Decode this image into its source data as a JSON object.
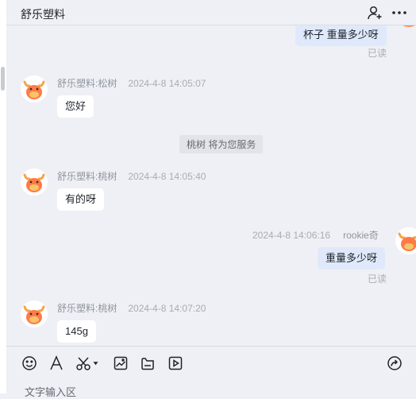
{
  "header": {
    "title": "舒乐塑料"
  },
  "messages": {
    "m0": {
      "text": "杯子 重量多少呀",
      "read": "已读"
    },
    "m1": {
      "sender": "舒乐塑料:松树",
      "time": "2024-4-8 14:05:07",
      "text": "您好"
    },
    "system": {
      "text": "桃树 将为您服务"
    },
    "m2": {
      "sender": "舒乐塑料:桃树",
      "time": "2024-4-8 14:05:40",
      "text": "有的呀"
    },
    "m3": {
      "sender": "rookie奇",
      "time": "2024-4-8 14:06:16",
      "text": "重量多少呀",
      "read": "已读"
    },
    "m4": {
      "sender": "舒乐塑料:桃树",
      "time": "2024-4-8 14:07:20",
      "text": "145g"
    }
  },
  "composer": {
    "placeholder": "文字输入区"
  },
  "colors": {
    "background": "#eff0f5",
    "bubble_incoming": "#ffffff",
    "bubble_outgoing": "#dfe9fb",
    "avatar_orange": "#ff7a45"
  },
  "icons": {
    "header": [
      "add-user-icon",
      "more-icon"
    ],
    "toolbar": [
      "emoji-icon",
      "font-icon",
      "scissors-icon",
      "image-icon",
      "file-icon",
      "video-icon",
      "share-icon"
    ]
  }
}
